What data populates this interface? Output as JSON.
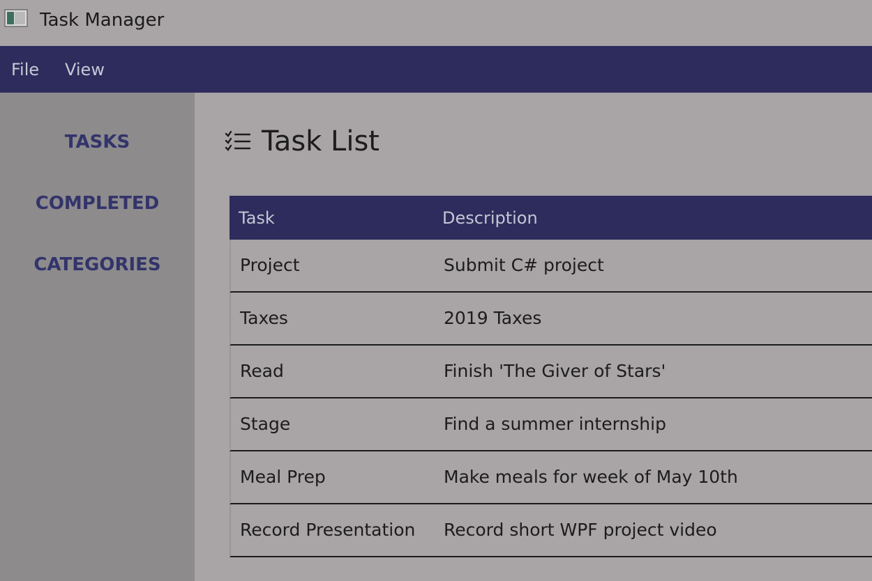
{
  "window": {
    "title": "Task Manager"
  },
  "menu": {
    "items": [
      {
        "label": "File"
      },
      {
        "label": "View"
      }
    ]
  },
  "sidebar": {
    "items": [
      {
        "label": "TASKS"
      },
      {
        "label": "COMPLETED"
      },
      {
        "label": "CATEGORIES"
      }
    ]
  },
  "main": {
    "heading": "Task List",
    "heading_icon": "checklist-icon",
    "table": {
      "columns": [
        "Task",
        "Description"
      ],
      "rows": [
        {
          "task": "Project",
          "description": "Submit C# project"
        },
        {
          "task": "Taxes",
          "description": "2019 Taxes"
        },
        {
          "task": "Read",
          "description": "Finish 'The Giver of Stars'"
        },
        {
          "task": "Stage",
          "description": "Find a summer internship"
        },
        {
          "task": "Meal Prep",
          "description": "Make meals for week of May 10th"
        },
        {
          "task": "Record Presentation",
          "description": "Record short WPF project video"
        }
      ]
    }
  },
  "colors": {
    "accent": "#2e2c5c",
    "nav_text": "#33346b",
    "sidebar_bg": "#8d8b8c",
    "content_bg": "#a9a4a6"
  }
}
